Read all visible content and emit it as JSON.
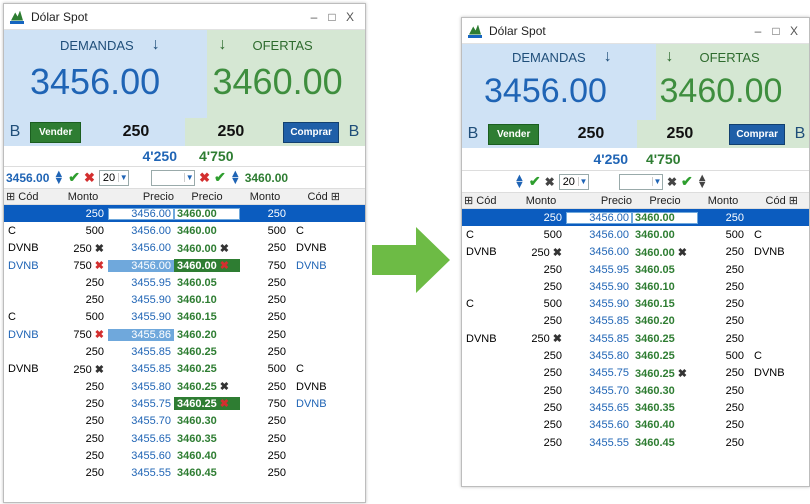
{
  "window_title": "Dólar Spot",
  "window_buttons": {
    "minimize": "–",
    "maximize": "□",
    "close": "X"
  },
  "demand_label": "DEMANDAS",
  "offer_label": "OFERTAS",
  "demand_price": "3456.00",
  "offer_price": "3460.00",
  "b_flag": "B",
  "sell_label": "Vender",
  "buy_label": "Comprar",
  "sell_qty": "250",
  "buy_qty": "250",
  "total_demand": "4'250",
  "total_offer": "4'750",
  "left_controls": {
    "bid_price": "3456.00",
    "qty_select": "20",
    "ask_price": "3460.00"
  },
  "right_controls": {
    "qty_select": "20"
  },
  "columns": {
    "cod": "Cód",
    "monto": "Monto",
    "precio": "Precio"
  },
  "left_rows": [
    {
      "cod": "",
      "m1": "250",
      "p1": "3456.00",
      "p2": "3460.00",
      "m2": "250",
      "cod2": ""
    },
    {
      "cod": "C",
      "m1": "500",
      "p1": "3456.00",
      "p2": "3460.00",
      "m2": "500",
      "cod2": "C"
    },
    {
      "cod": "DVNB",
      "m1": "250",
      "p1": "3456.00",
      "p2": "3460.00",
      "m2": "250",
      "cod2": "DVNB"
    },
    {
      "cod": "DVNB",
      "m1": "750",
      "p1": "3456.00",
      "p2": "3460.00",
      "m2": "750",
      "cod2": "DVNB"
    },
    {
      "cod": "",
      "m1": "250",
      "p1": "3455.95",
      "p2": "3460.05",
      "m2": "250",
      "cod2": ""
    },
    {
      "cod": "",
      "m1": "250",
      "p1": "3455.90",
      "p2": "3460.10",
      "m2": "250",
      "cod2": ""
    },
    {
      "cod": "C",
      "m1": "500",
      "p1": "3455.90",
      "p2": "3460.15",
      "m2": "250",
      "cod2": ""
    },
    {
      "cod": "DVNB",
      "m1": "750",
      "p1": "3455.86",
      "p2": "3460.20",
      "m2": "250",
      "cod2": ""
    },
    {
      "cod": "",
      "m1": "250",
      "p1": "3455.85",
      "p2": "3460.25",
      "m2": "250",
      "cod2": ""
    },
    {
      "cod": "DVNB",
      "m1": "250",
      "p1": "3455.85",
      "p2": "3460.25",
      "m2": "500",
      "cod2": "C"
    },
    {
      "cod": "",
      "m1": "250",
      "p1": "3455.80",
      "p2": "3460.25",
      "m2": "250",
      "cod2": "DVNB"
    },
    {
      "cod": "",
      "m1": "250",
      "p1": "3455.75",
      "p2": "3460.25",
      "m2": "750",
      "cod2": "DVNB"
    },
    {
      "cod": "",
      "m1": "250",
      "p1": "3455.70",
      "p2": "3460.30",
      "m2": "250",
      "cod2": ""
    },
    {
      "cod": "",
      "m1": "250",
      "p1": "3455.65",
      "p2": "3460.35",
      "m2": "250",
      "cod2": ""
    },
    {
      "cod": "",
      "m1": "250",
      "p1": "3455.60",
      "p2": "3460.40",
      "m2": "250",
      "cod2": ""
    },
    {
      "cod": "",
      "m1": "250",
      "p1": "3455.55",
      "p2": "3460.45",
      "m2": "250",
      "cod2": ""
    }
  ],
  "right_rows": [
    {
      "cod": "",
      "m1": "250",
      "p1": "3456.00",
      "p2": "3460.00",
      "m2": "250",
      "cod2": ""
    },
    {
      "cod": "C",
      "m1": "500",
      "p1": "3456.00",
      "p2": "3460.00",
      "m2": "500",
      "cod2": "C"
    },
    {
      "cod": "DVNB",
      "m1": "250",
      "p1": "3456.00",
      "p2": "3460.00",
      "m2": "250",
      "cod2": "DVNB"
    },
    {
      "cod": "",
      "m1": "250",
      "p1": "3455.95",
      "p2": "3460.05",
      "m2": "250",
      "cod2": ""
    },
    {
      "cod": "",
      "m1": "250",
      "p1": "3455.90",
      "p2": "3460.10",
      "m2": "250",
      "cod2": ""
    },
    {
      "cod": "C",
      "m1": "500",
      "p1": "3455.90",
      "p2": "3460.15",
      "m2": "250",
      "cod2": ""
    },
    {
      "cod": "",
      "m1": "250",
      "p1": "3455.85",
      "p2": "3460.20",
      "m2": "250",
      "cod2": ""
    },
    {
      "cod": "DVNB",
      "m1": "250",
      "p1": "3455.85",
      "p2": "3460.25",
      "m2": "250",
      "cod2": ""
    },
    {
      "cod": "",
      "m1": "250",
      "p1": "3455.80",
      "p2": "3460.25",
      "m2": "500",
      "cod2": "C"
    },
    {
      "cod": "",
      "m1": "250",
      "p1": "3455.75",
      "p2": "3460.25",
      "m2": "250",
      "cod2": "DVNB"
    },
    {
      "cod": "",
      "m1": "250",
      "p1": "3455.70",
      "p2": "3460.30",
      "m2": "250",
      "cod2": ""
    },
    {
      "cod": "",
      "m1": "250",
      "p1": "3455.65",
      "p2": "3460.35",
      "m2": "250",
      "cod2": ""
    },
    {
      "cod": "",
      "m1": "250",
      "p1": "3455.60",
      "p2": "3460.40",
      "m2": "250",
      "cod2": ""
    },
    {
      "cod": "",
      "m1": "250",
      "p1": "3455.55",
      "p2": "3460.45",
      "m2": "250",
      "cod2": ""
    }
  ],
  "colors": {
    "demand_bg": "#cfe2f5",
    "offer_bg": "#d5e7d3",
    "arrow": "#6dbb45",
    "selected_row": "#0b5cbf"
  }
}
